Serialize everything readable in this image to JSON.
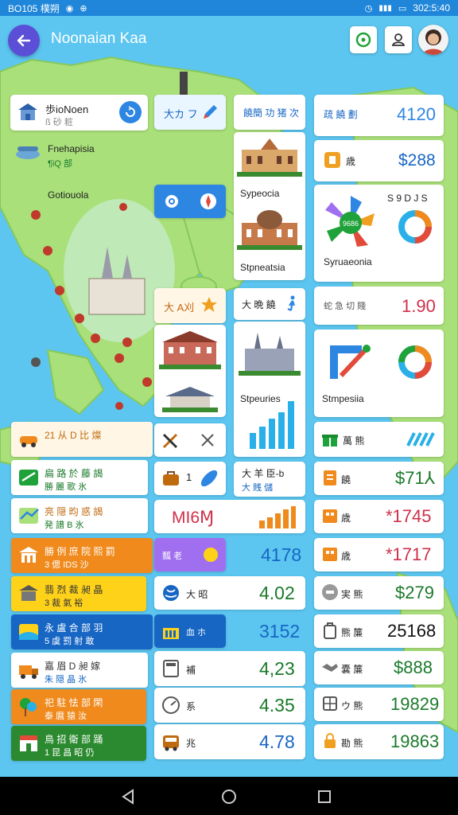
{
  "statusbar": {
    "time_label": "BO105 樸朔",
    "battery_label": "302:5:40"
  },
  "appbar": {
    "title": "Noonaian Kaa"
  },
  "map": {
    "places": [
      {
        "name": "Gotiouola"
      }
    ]
  },
  "left_cards": {
    "c1": {
      "title": "歩ioNoen",
      "sub": "ß 砂 粧"
    },
    "c2": {
      "title": "Fnehapisia",
      "sub": "¶iQ 部"
    },
    "c3": {
      "title": "Gotiouola"
    }
  },
  "col2": {
    "tile1": {
      "label": "大カ フ"
    },
    "tile3": {
      "label": "大 A刈"
    }
  },
  "col3": {
    "header": "饒簡 功 猪 次",
    "img1_caption": "Sypeocia",
    "img2_caption": "Stpneatsia",
    "sub_header": "大 晩 饒",
    "caption3": "Stpeuries",
    "card_title": "大 羊 臣-b",
    "card_sub": "大 賎 儲"
  },
  "col4": {
    "header_label": "疏 饒 劃",
    "header_value": "4120",
    "row1_label": "歳",
    "row1_value": "$288",
    "chart_top_label": "S 9 D J S",
    "chart_caption": "Syruaeonia",
    "chart_center": "9686",
    "row2_label": "蛇 急 切 賤",
    "row2_value": "1.90",
    "chart2_caption": "Stmpesiia",
    "row3_label": "萬 熊"
  },
  "left_rows": [
    {
      "id": "r1",
      "l1": "21 从 D 比 燦",
      "l2": ""
    },
    {
      "id": "r2",
      "l1": "扁 路 於 藤 謁",
      "l2": "勝 麗 歌 氷"
    },
    {
      "id": "r3",
      "l1": "亮 隠 昀 惑 謁",
      "l2": "発 譜 B 氷"
    },
    {
      "id": "r4",
      "l1": "勝 例 庶 院 熙 罰",
      "l2": "3 偲 IDS 沙"
    },
    {
      "id": "r5",
      "l1": "翡 烈 裁 昶 晶",
      "l2": "3 裁 氣 裕"
    },
    {
      "id": "r6",
      "l1": "永 盧 合 部 羽",
      "l2": "5 虞 罰 射 敢"
    },
    {
      "id": "r7",
      "l1": "嘉 眉 D 昶 嫁",
      "l2": "朱 隠 晶 氷"
    },
    {
      "id": "r8",
      "l1": "祀 駐 怯 部 閑",
      "l2": "泰 麿 猿 汝"
    },
    {
      "id": "r9",
      "l1": "鳥 招 衛 部 踊",
      "l2": "1 昆 昌 昭 仍"
    }
  ],
  "mid_rows": [
    {
      "id": "m1",
      "label": "",
      "value": ""
    },
    {
      "id": "m2",
      "label": "1",
      "value": ""
    },
    {
      "id": "m3",
      "label": "",
      "value": "MI6Ɱ"
    },
    {
      "id": "m4",
      "label": "瓢 老",
      "value": "4178"
    },
    {
      "id": "m5",
      "label": "大 昭",
      "value": "4.02"
    },
    {
      "id": "m6",
      "label": "血 ホ",
      "value": "3152"
    },
    {
      "id": "m7",
      "label": "補",
      "value": "4,23"
    },
    {
      "id": "m8",
      "label": "系",
      "value": "4.35"
    },
    {
      "id": "m9",
      "label": "兆",
      "value": "4.78"
    }
  ],
  "right_rows": [
    {
      "id": "rr1",
      "label": "饒",
      "value": "$71⅄"
    },
    {
      "id": "rr2",
      "label": "歳",
      "value": "*1745"
    },
    {
      "id": "rr3",
      "label": "歳",
      "value": "*1717"
    },
    {
      "id": "rr4",
      "label": "実 熊",
      "value": "$279"
    },
    {
      "id": "rr5",
      "label": "熊 簾",
      "value": "25168"
    },
    {
      "id": "rr6",
      "label": "嚢 簾",
      "value": "$888"
    },
    {
      "id": "rr7",
      "label": "ウ 熊",
      "value": "19829"
    },
    {
      "id": "rr8",
      "label": "勘 熊",
      "value": "19863"
    }
  ],
  "colors": {
    "statusbar": "#1f86d9",
    "ocean": "#5cc6f0",
    "land": "#a9e07a",
    "accent_blue": "#2d86e2",
    "green": "#1fa23a",
    "orange": "#f08a1c",
    "yellow": "#ffd21a",
    "navy": "#1766c4",
    "dark_green": "#2b8a2f",
    "purple": "#a06ff0"
  }
}
